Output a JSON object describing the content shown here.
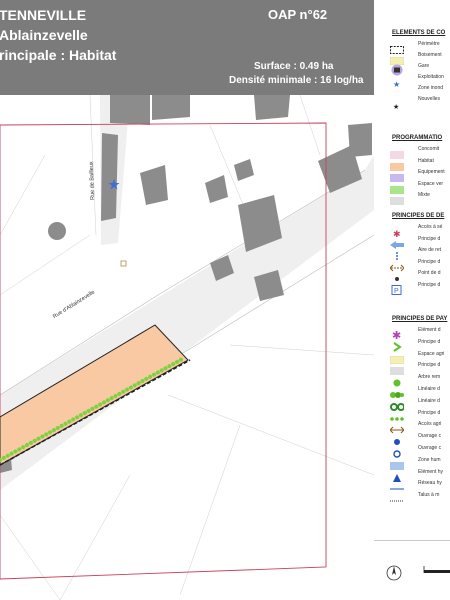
{
  "header": {
    "commune": "TENNEVILLE",
    "site": "Ablainzevelle",
    "vocation": "rincipale : Habitat",
    "oap": "OAP n°62",
    "surface": "Surface : 0.49 ha",
    "densite": "Densité minimale : 16 log/ha"
  },
  "map": {
    "streets": [
      "Rue de Bailleux",
      "Rue d'Ablainzevelle"
    ],
    "colors": {
      "habitat": "#f9c9a3",
      "hedge": "#7dd23f",
      "perimeter": "#c8405f",
      "building": "#8a8a8a",
      "road": "#e6e6e6"
    }
  },
  "legend": {
    "sections": [
      {
        "title": "ELEMENTS DE CO",
        "items": [
          {
            "icon": "dashed-rectangle-icon",
            "label": "Périmètre"
          },
          {
            "icon": "yellow-swatch-icon",
            "label": "Boisement"
          },
          {
            "icon": "gare-circle-icon",
            "label": "Gare"
          },
          {
            "icon": "blue-star-icon",
            "label": "Exploitation"
          },
          {
            "icon": "blank-icon",
            "label": "Zone inond"
          },
          {
            "icon": "black-star-icon",
            "label": "Nouvelles"
          }
        ]
      },
      {
        "title": "PROGRAMMATIO",
        "items": [
          {
            "icon": "pink-swatch-icon",
            "label": "Concomit"
          },
          {
            "icon": "orange-swatch-icon",
            "label": "Habitat"
          },
          {
            "icon": "purple-swatch-icon",
            "label": "Equipement"
          },
          {
            "icon": "green-swatch-icon",
            "label": "Espace ver"
          },
          {
            "icon": "grey-swatch-icon",
            "label": "Mixte"
          }
        ]
      },
      {
        "title": "PRINCIPES DE DE",
        "items": [
          {
            "icon": "red-asterisk-icon",
            "label": "Accès à sé"
          },
          {
            "icon": "blue-arrow-icon",
            "label": "Principe d"
          },
          {
            "icon": "dotted-vertical-icon",
            "label": "Aire de ret"
          },
          {
            "icon": "double-arrow-icon",
            "label": "Principe d"
          },
          {
            "icon": "point-icon",
            "label": "Point de d"
          },
          {
            "icon": "parking-icon",
            "label": "Principe d"
          }
        ]
      },
      {
        "title": "PRINCIPES DE PAY",
        "items": [
          {
            "icon": "purple-asterisk-icon",
            "label": "Elément d"
          },
          {
            "icon": "green-chevron-icon",
            "label": "Principe d"
          },
          {
            "icon": "yellow-swatch-icon",
            "label": "Espace agri"
          },
          {
            "icon": "grey-swatch-icon",
            "label": "Principe d"
          },
          {
            "icon": "green-circle-icon",
            "label": "Arbre rem"
          },
          {
            "icon": "tree-line-icon",
            "label": "Linéaire d"
          },
          {
            "icon": "double-circle-icon",
            "label": "Linéaire d"
          },
          {
            "icon": "green-dots-icon",
            "label": "Principe d"
          },
          {
            "icon": "brown-arrow-icon",
            "label": "Accès agri"
          },
          {
            "icon": "blue-dot-icon",
            "label": "Ouvrage c"
          },
          {
            "icon": "blue-ring-icon",
            "label": "Ouvrage c"
          },
          {
            "icon": "light-blue-swatch-icon",
            "label": "Zone hum"
          },
          {
            "icon": "blue-triangle-icon",
            "label": "Elément hy"
          },
          {
            "icon": "blue-line-icon",
            "label": "Réseau hy"
          },
          {
            "icon": "dotted-line-icon",
            "label": "Talus à m"
          }
        ]
      }
    ]
  }
}
